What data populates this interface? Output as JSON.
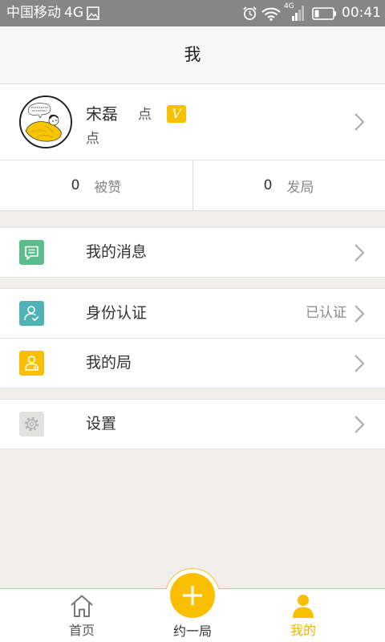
{
  "status_bar": {
    "carrier": "中国移动",
    "network": "4G",
    "signal_badge": "4G",
    "time": "00:41",
    "icons": [
      "image-icon",
      "alarm-icon",
      "wifi-icon",
      "signal-icon",
      "battery-icon"
    ]
  },
  "header": {
    "title": "我"
  },
  "profile": {
    "name": "宋磊",
    "name_suffix": "点",
    "badge": "V",
    "subtitle": "点",
    "icon": "chevron-right-icon"
  },
  "stats": [
    {
      "count": "0",
      "label": "被赞"
    },
    {
      "count": "0",
      "label": "发局"
    }
  ],
  "menu": [
    {
      "label": "我的消息",
      "icon": "message-icon",
      "icon_color": "#5cbd8a"
    },
    {
      "label": "身份认证",
      "status": "已认证",
      "icon": "identity-icon",
      "icon_color": "#4fb3b6"
    },
    {
      "label": "我的局",
      "icon": "my-games-icon",
      "icon_color": "#f8c000"
    },
    {
      "label": "设置",
      "icon": "gear-icon",
      "icon_color": "#e2e2e0"
    }
  ],
  "tabbar": {
    "tabs": [
      {
        "label": "首页",
        "icon": "home-icon",
        "active": false
      },
      {
        "label": "约一局",
        "icon": "plus-icon",
        "active": false
      },
      {
        "label": "我的",
        "icon": "person-icon",
        "active": true
      }
    ]
  },
  "colors": {
    "accent": "#f8c000",
    "status_bar": "#868686",
    "header_bg": "#f7f7f7",
    "page_bg": "#f0efeb",
    "text": "#333333",
    "muted_text": "#888888",
    "chevron": "#a9a9a9"
  }
}
